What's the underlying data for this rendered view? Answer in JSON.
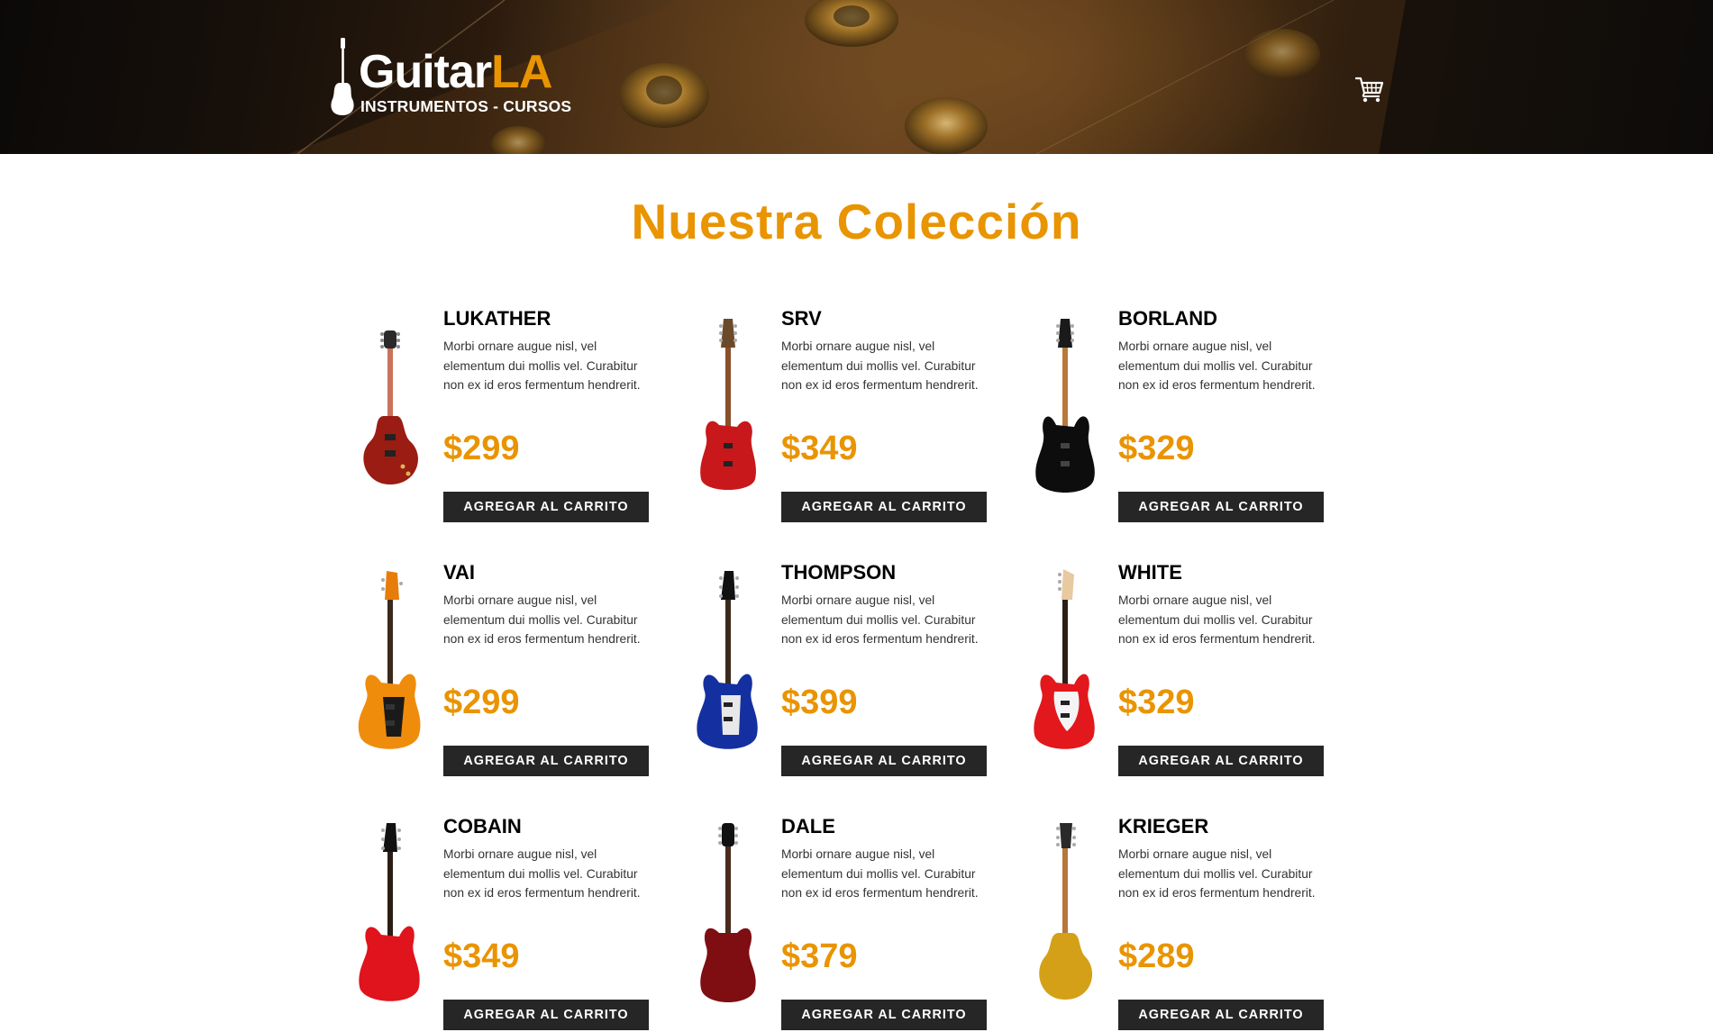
{
  "header": {
    "logo": {
      "word_white": "Guitar",
      "word_accent": "LA",
      "subtitle": "INSTRUMENTOS - CURSOS"
    },
    "cart_icon": "shopping-cart-icon"
  },
  "main": {
    "title": "Nuestra Colección",
    "products": [
      {
        "name": "Lukather",
        "description": "Morbi ornare augue nisl, vel elementum dui mollis vel. Curabitur non ex id eros fermentum hendrerit.",
        "price": "$299",
        "button": "Agregar al Carrito"
      },
      {
        "name": "SRV",
        "description": "Morbi ornare augue nisl, vel elementum dui mollis vel. Curabitur non ex id eros fermentum hendrerit.",
        "price": "$349",
        "button": "Agregar al Carrito"
      },
      {
        "name": "Borland",
        "description": "Morbi ornare augue nisl, vel elementum dui mollis vel. Curabitur non ex id eros fermentum hendrerit.",
        "price": "$329",
        "button": "Agregar al Carrito"
      },
      {
        "name": "Vai",
        "description": "Morbi ornare augue nisl, vel elementum dui mollis vel. Curabitur non ex id eros fermentum hendrerit.",
        "price": "$299",
        "button": "Agregar al Carrito"
      },
      {
        "name": "Thompson",
        "description": "Morbi ornare augue nisl, vel elementum dui mollis vel. Curabitur non ex id eros fermentum hendrerit.",
        "price": "$399",
        "button": "Agregar al Carrito"
      },
      {
        "name": "White",
        "description": "Morbi ornare augue nisl, vel elementum dui mollis vel. Curabitur non ex id eros fermentum hendrerit.",
        "price": "$329",
        "button": "Agregar al Carrito"
      },
      {
        "name": "Cobain",
        "description": "Morbi ornare augue nisl, vel elementum dui mollis vel. Curabitur non ex id eros fermentum hendrerit.",
        "price": "$349",
        "button": "Agregar al Carrito"
      },
      {
        "name": "Dale",
        "description": "Morbi ornare augue nisl, vel elementum dui mollis vel. Curabitur non ex id eros fermentum hendrerit.",
        "price": "$379",
        "button": "Agregar al Carrito"
      },
      {
        "name": "Krieger",
        "description": "Morbi ornare augue nisl, vel elementum dui mollis vel. Curabitur non ex id eros fermentum hendrerit.",
        "price": "$289",
        "button": "Agregar al Carrito"
      }
    ]
  },
  "colors": {
    "accent": "#e99401",
    "button_bg": "#262626",
    "text": "#000000"
  }
}
